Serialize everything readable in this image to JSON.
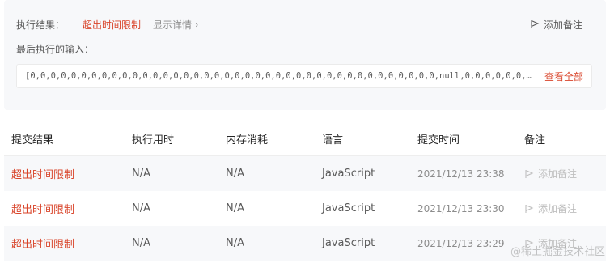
{
  "result": {
    "label": "执行结果：",
    "status": "超出时间限制",
    "details_link": "显示详情",
    "add_note": "添加备注",
    "last_input_label": "最后执行的输入：",
    "last_input_value": "[0,0,0,0,0,0,0,0,0,0,0,0,0,0,0,0,0,0,0,0,0,0,0,0,0,0,0,0,0,0,0,0,0,0,0,0,0,0,0,0,null,0,0,0,0,0,0,0,0,0,0,0,0,0,0,0,null,0,0,0,0,0,0,0,0,0,null,0,0,0,...",
    "view_all": "查看全部"
  },
  "table": {
    "headers": [
      "提交结果",
      "执行用时",
      "内存消耗",
      "语言",
      "提交时间",
      "备注"
    ],
    "rows": [
      {
        "status": "超出时间限制",
        "runtime": "N/A",
        "memory": "N/A",
        "language": "JavaScript",
        "time": "2021/12/13 23:38",
        "note": "添加备注"
      },
      {
        "status": "超出时间限制",
        "runtime": "N/A",
        "memory": "N/A",
        "language": "JavaScript",
        "time": "2021/12/13 23:30",
        "note": "添加备注"
      },
      {
        "status": "超出时间限制",
        "runtime": "N/A",
        "memory": "N/A",
        "language": "JavaScript",
        "time": "2021/12/13 23:29",
        "note": "添加备注"
      }
    ]
  },
  "watermark": "@稀土掘金技术社区",
  "colors": {
    "error": "#d9452b",
    "muted": "#8c8c8c",
    "panel_bg": "#f7f8fa"
  }
}
